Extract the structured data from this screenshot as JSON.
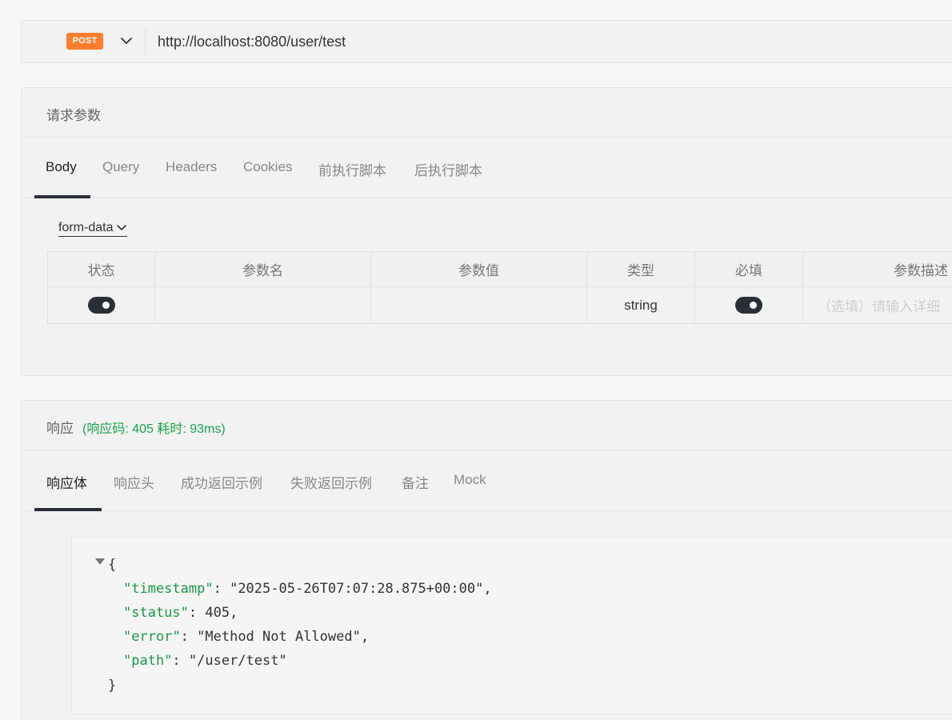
{
  "request": {
    "method": "POST",
    "url": "http://localhost:8080/user/test"
  },
  "params_panel": {
    "title": "请求参数",
    "tabs": [
      "Body",
      "Query",
      "Headers",
      "Cookies",
      "前执行脚本",
      "后执行脚本"
    ],
    "active_tab": "Body",
    "body_type": "form-data",
    "table": {
      "headers": [
        "状态",
        "参数名",
        "参数值",
        "类型",
        "必填",
        "参数描述"
      ],
      "rows": [
        {
          "enabled": true,
          "name": "",
          "value": "",
          "type": "string",
          "required": true,
          "description_placeholder": "（选填）请输入详细"
        }
      ]
    }
  },
  "response_panel": {
    "title": "响应",
    "status_text": "(响应码: 405 耗时: 93ms)",
    "tabs": [
      "响应体",
      "响应头",
      "成功返回示例",
      "失败返回示例",
      "备注",
      "Mock"
    ],
    "active_tab": "响应体",
    "body": {
      "timestamp": "2025-05-26T07:07:28.875+00:00",
      "status": "405",
      "error": "Method Not Allowed",
      "path": "/user/test"
    }
  },
  "colors": {
    "method_badge": "#fe7d2e",
    "status_green": "#1aa34a",
    "json_key": "#1a9940",
    "toggle": "#2a2f37"
  }
}
